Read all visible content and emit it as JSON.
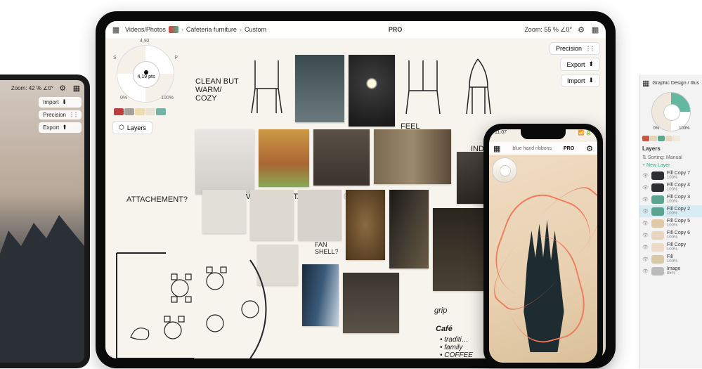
{
  "left_device": {
    "zoom_label": "Zoom: 42 % ∠0°",
    "pills": [
      "Import",
      "Precision",
      "Export"
    ]
  },
  "ipad": {
    "breadcrumb": [
      "Videos/Photos",
      "Cafeteria furniture",
      "Custom"
    ],
    "badge": "PRO",
    "zoom_label": "Zoom: 55 % ∠0°",
    "radial": {
      "top": "4,92",
      "center": "4,19 pts",
      "left": "0%",
      "right": "100%",
      "s_label": "S",
      "p_label": "P"
    },
    "palette": [
      "#be3d3a",
      "#a8a39a",
      "#ecdcae",
      "#e9e3d6",
      "#6fb5a6"
    ],
    "layers_label": "Layers",
    "right_pills": [
      {
        "label": "Precision",
        "icon": "dots"
      },
      {
        "label": "Export",
        "icon": "ul"
      },
      {
        "label": "Import",
        "icon": "dl"
      }
    ],
    "annotations": {
      "clean": "CLEAN BUT\nWARM/\nCOZY",
      "attachment": "ATTACHEMENT?",
      "curve": "CURVE",
      "stance": "STANCE",
      "organic": "ORGANIC",
      "feel": "FEEL",
      "industrial": "INDUSTRIAL?",
      "fan": "FAN\nSHELL?",
      "grip": "grip",
      "cafe_head": "Café",
      "cafe_items": [
        "traditi…",
        "family",
        "COFFEE"
      ]
    }
  },
  "iphone": {
    "time": "11:07",
    "title": "blue hand ribbons",
    "badge": "PRO"
  },
  "right_panel": {
    "breadcrumb": "Graphic Design / Illustrations",
    "radial": {
      "left": "0%",
      "right": "100%"
    },
    "palette": [
      "#c9573f",
      "#e8d4b8",
      "#5da98e",
      "#e6d9c0",
      "#f0e8d8"
    ],
    "layers_title": "Layers",
    "sorting_label": "Sorting:",
    "sorting_value": "Manual",
    "new_layer": "+ New Layer",
    "layers": [
      {
        "name": "Fill Copy 7",
        "opacity": "100%",
        "color": "#2b2f33"
      },
      {
        "name": "Fill Copy 4",
        "opacity": "100%",
        "color": "#2b2f33"
      },
      {
        "name": "Fill Copy 3",
        "opacity": "100%",
        "color": "#5aa591"
      },
      {
        "name": "Fill Copy 2",
        "opacity": "100%",
        "color": "#5aa591",
        "selected": true
      },
      {
        "name": "Fill Copy 5",
        "opacity": "100%",
        "color": "#e2c9a8"
      },
      {
        "name": "Fill Copy 6",
        "opacity": "100%",
        "color": "#e9d4c0"
      },
      {
        "name": "Fill Copy",
        "opacity": "100%",
        "color": "#efdac8"
      },
      {
        "name": "Fill",
        "opacity": "100%",
        "color": "#d9c8a6"
      },
      {
        "name": "Image",
        "opacity": "85%",
        "color": "#bbb"
      }
    ]
  }
}
